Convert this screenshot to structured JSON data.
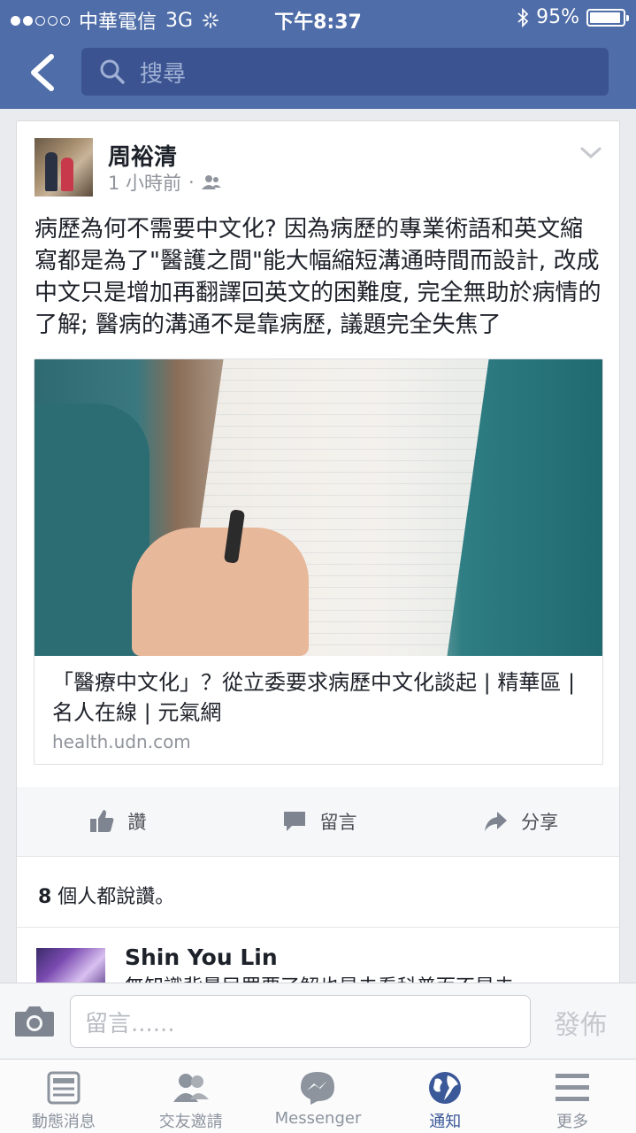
{
  "status_bar": {
    "carrier": "中華電信",
    "network": "3G",
    "time": "下午8:37",
    "battery": "95%",
    "battery_level": 0.95
  },
  "header": {
    "search_placeholder": "搜尋"
  },
  "post": {
    "author": "周裕清",
    "timestamp": "1 小時前",
    "text": "病歷為何不需要中文化? 因為病歷的專業術語和英文縮寫都是為了\"醫護之間\"能大幅縮短溝通時間而設計, 改成中文只是增加再翻譯回英文的困難度, 完全無助於病情的了解; 醫病的溝通不是靠病歷, 議題完全失焦了",
    "link": {
      "title": "「醫療中文化」？從立委要求病歷中文化談起 | 精華區 | 名人在線 | 元氣網",
      "domain": "health.udn.com"
    },
    "actions": {
      "like": "讚",
      "comment": "留言",
      "share": "分享"
    },
    "likes_count": "8",
    "likes_suffix": " 個人都說讚。"
  },
  "comment": {
    "author": "Shin You Lin",
    "text": "無知識背景民眾要了解也是去看科普而不是去"
  },
  "composer": {
    "placeholder": "留言......",
    "post_label": "發佈"
  },
  "tabs": [
    {
      "label": "動態消息",
      "icon": "news-feed-icon"
    },
    {
      "label": "交友邀請",
      "icon": "friends-icon"
    },
    {
      "label": "Messenger",
      "icon": "messenger-icon"
    },
    {
      "label": "通知",
      "icon": "globe-icon",
      "active": true
    },
    {
      "label": "更多",
      "icon": "menu-icon"
    }
  ],
  "colors": {
    "header": "#4f6da8",
    "search_bg": "#3b5491",
    "active_tab": "#3b5998"
  }
}
